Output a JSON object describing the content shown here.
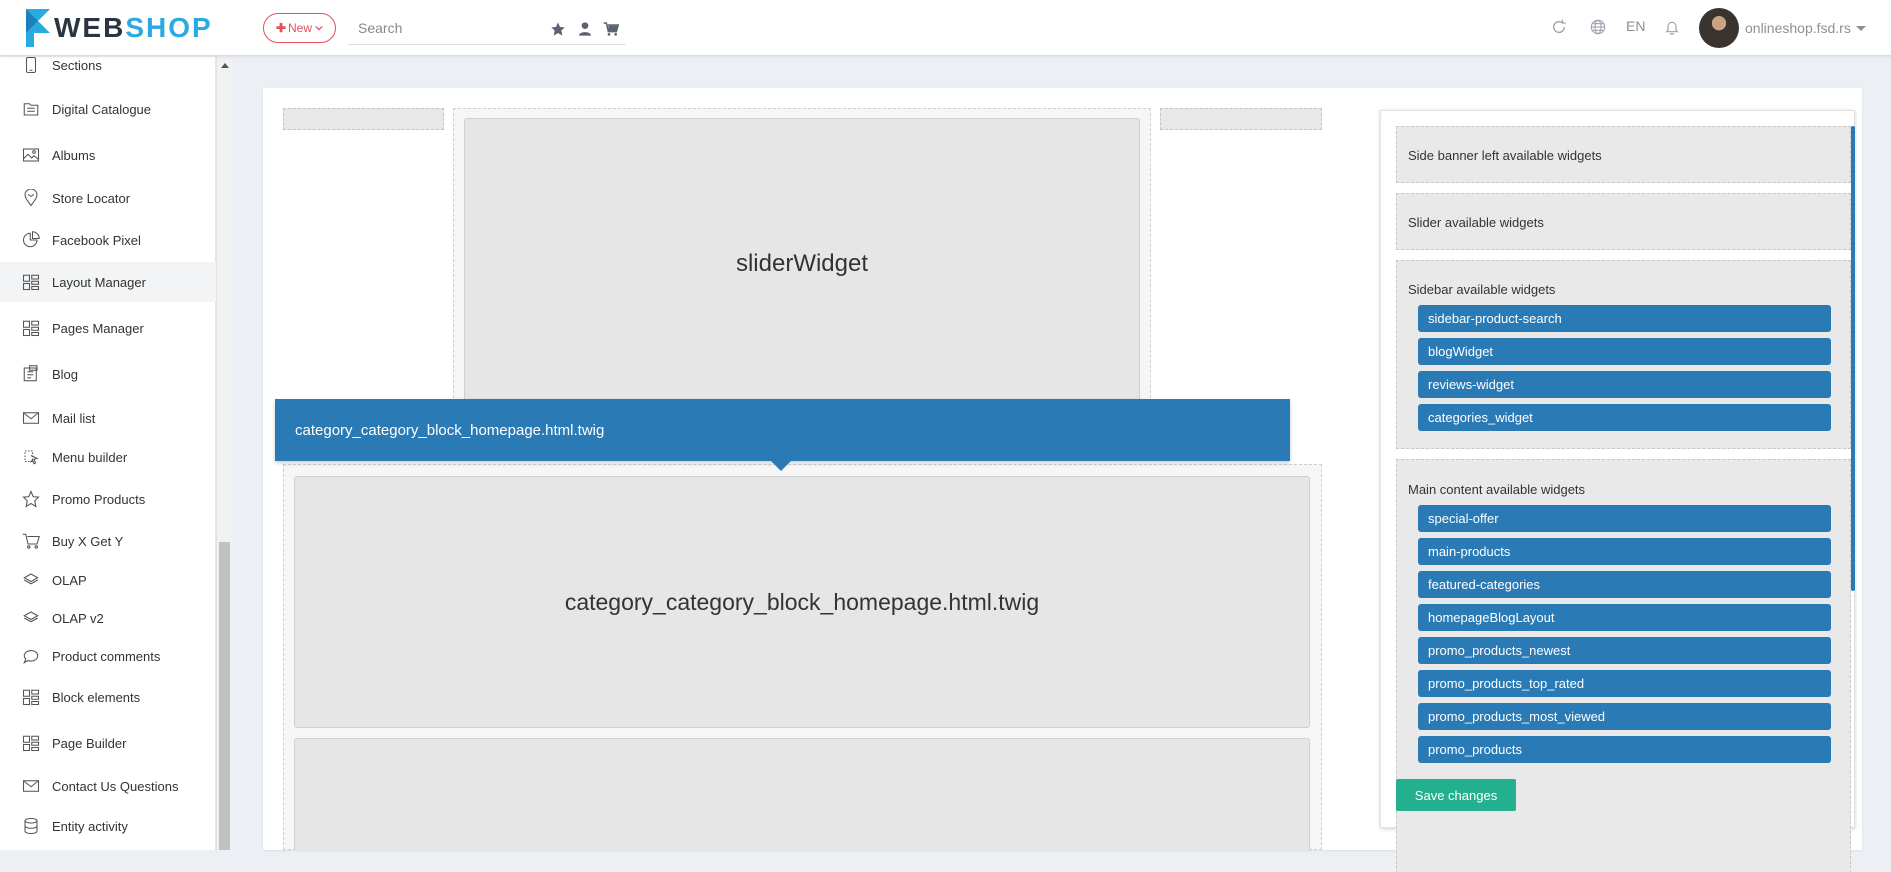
{
  "header": {
    "logo": {
      "part1": "WEB",
      "part2": "SHOP"
    },
    "new_button": "New",
    "search_placeholder": "Search",
    "language": "EN",
    "user_name": "onlineshop.fsd.rs"
  },
  "sidebar": {
    "items": [
      {
        "label": "Sections",
        "icon": "mobile-icon"
      },
      {
        "label": "Digital Catalogue",
        "icon": "catalogue-icon"
      },
      {
        "label": "Albums",
        "icon": "image-icon"
      },
      {
        "label": "Store Locator",
        "icon": "map-pin-icon"
      },
      {
        "label": "Facebook Pixel",
        "icon": "pie-chart-icon"
      },
      {
        "label": "Layout Manager",
        "icon": "layout-icon",
        "active": true
      },
      {
        "label": "Pages Manager",
        "icon": "layout-icon"
      },
      {
        "label": "Blog",
        "icon": "blog-icon"
      },
      {
        "label": "Mail list",
        "icon": "mail-icon"
      },
      {
        "label": "Menu builder",
        "icon": "menu-builder-icon"
      },
      {
        "label": "Promo Products",
        "icon": "star-icon"
      },
      {
        "label": "Buy X Get Y",
        "icon": "cart-icon"
      },
      {
        "label": "OLAP",
        "icon": "layers-icon"
      },
      {
        "label": "OLAP v2",
        "icon": "layers-icon"
      },
      {
        "label": "Product comments",
        "icon": "comment-icon"
      },
      {
        "label": "Block elements",
        "icon": "layout-icon"
      },
      {
        "label": "Page Builder",
        "icon": "layout-icon"
      },
      {
        "label": "Contact Us Questions",
        "icon": "mail-icon"
      },
      {
        "label": "Entity activity",
        "icon": "database-icon"
      }
    ]
  },
  "layout": {
    "slider_widget": "sliderWidget",
    "block_widget": "category_category_block_homepage.html.twig",
    "tooltip": "category_category_block_homepage.html.twig"
  },
  "widgets": {
    "sections": [
      {
        "title": "Side banner left available widgets",
        "items": []
      },
      {
        "title": "Slider available widgets",
        "items": []
      },
      {
        "title": "Sidebar available widgets",
        "items": [
          "sidebar-product-search",
          "blogWidget",
          "reviews-widget",
          "categories_widget"
        ]
      },
      {
        "title": "Main content available widgets",
        "items": [
          "special-offer",
          "main-products",
          "featured-categories",
          "homepageBlogLayout",
          "promo_products_newest",
          "promo_products_top_rated",
          "promo_products_most_viewed",
          "promo_products"
        ]
      }
    ],
    "save_label": "Save changes"
  },
  "colors": {
    "accent_blue": "#2a7ab6",
    "save_green": "#23b08e",
    "new_red": "#e4505b",
    "logo_blue": "#29aae1"
  }
}
